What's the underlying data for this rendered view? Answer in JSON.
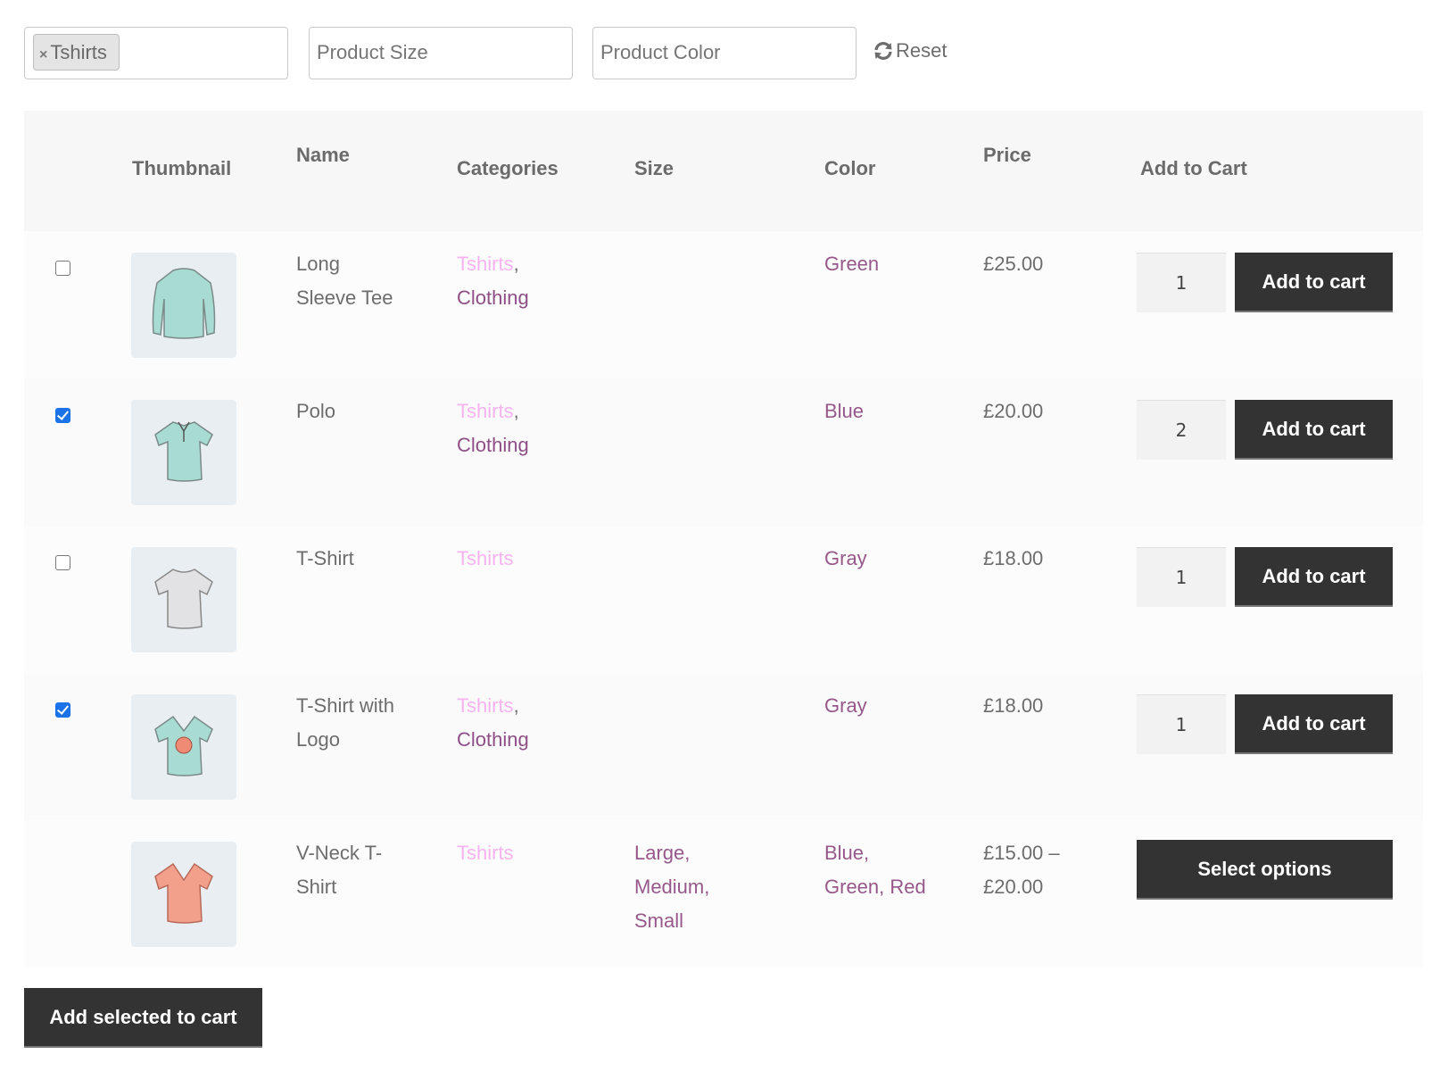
{
  "filters": {
    "category": {
      "selected_chip": "Tshirts",
      "remove_icon": "×"
    },
    "size": {
      "placeholder": "Product Size"
    },
    "color": {
      "placeholder": "Product Color"
    },
    "reset_label": "Reset"
  },
  "table": {
    "headers": {
      "thumbnail": "Thumbnail",
      "name": "Name",
      "categories": "Categories",
      "size": "Size",
      "color": "Color",
      "price": "Price",
      "add_to_cart": "Add to Cart"
    },
    "rows": [
      {
        "checked": false,
        "thumbnail_icon": "long-sleeve-tee-image",
        "name_lines": [
          "Long",
          "Sleeve Tee"
        ],
        "categories": [
          "Tshirts",
          "Clothing"
        ],
        "size": [],
        "color": [
          "Green"
        ],
        "price_lines": [
          "£25.00"
        ],
        "quantity": "1",
        "button_label": "Add to cart"
      },
      {
        "checked": true,
        "thumbnail_icon": "polo-image",
        "name_lines": [
          "Polo"
        ],
        "categories": [
          "Tshirts",
          "Clothing"
        ],
        "size": [],
        "color": [
          "Blue"
        ],
        "price_lines": [
          "£20.00"
        ],
        "quantity": "2",
        "button_label": "Add to cart"
      },
      {
        "checked": false,
        "thumbnail_icon": "tshirt-image",
        "name_lines": [
          "T-Shirt"
        ],
        "categories": [
          "Tshirts"
        ],
        "size": [],
        "color": [
          "Gray"
        ],
        "price_lines": [
          "£18.00"
        ],
        "quantity": "1",
        "button_label": "Add to cart"
      },
      {
        "checked": true,
        "thumbnail_icon": "tshirt-with-logo-image",
        "name_lines": [
          "T-Shirt with",
          "Logo"
        ],
        "categories": [
          "Tshirts",
          "Clothing"
        ],
        "size": [],
        "color": [
          "Gray"
        ],
        "price_lines": [
          "£18.00"
        ],
        "quantity": "1",
        "button_label": "Add to cart"
      },
      {
        "checked": null,
        "thumbnail_icon": "vneck-tshirt-image",
        "name_lines": [
          "V-Neck T-",
          "Shirt"
        ],
        "categories": [
          "Tshirts"
        ],
        "size_lines": [
          "Large,",
          "Medium,",
          "Small"
        ],
        "color_lines": [
          "Blue,",
          "Green, Red"
        ],
        "price_lines": [
          "£15.00 –",
          "£20.00"
        ],
        "quantity": null,
        "button_label": "Select options"
      }
    ]
  },
  "add_selected_label": "Add selected to cart",
  "colors": {
    "button_bg": "#333333",
    "category_primary": "#f7b3f0",
    "category_secondary": "#8e4f86",
    "attribute_link": "#96588a",
    "checkbox_checked": "#1a73e8",
    "header_bg": "#f7f7f7"
  }
}
